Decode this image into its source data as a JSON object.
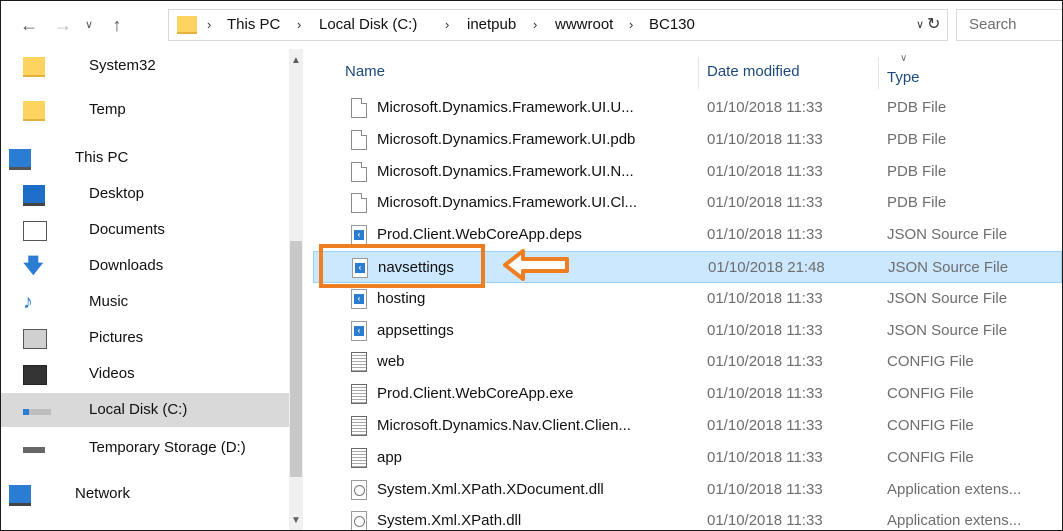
{
  "address_bar": {
    "crumbs": [
      "This PC",
      "Local Disk (C:)",
      "inetpub",
      "wwwroot",
      "BC130"
    ],
    "search_placeholder": "Search"
  },
  "nav_pane": {
    "items": [
      {
        "label": "System32",
        "icon": "folder-icon"
      },
      {
        "label": "Temp",
        "icon": "folder-icon"
      },
      {
        "label": "This PC",
        "icon": "computer-icon"
      },
      {
        "label": "Desktop",
        "icon": "desktop-icon"
      },
      {
        "label": "Documents",
        "icon": "documents-icon"
      },
      {
        "label": "Downloads",
        "icon": "downloads-icon"
      },
      {
        "label": "Music",
        "icon": "music-icon"
      },
      {
        "label": "Pictures",
        "icon": "pictures-icon"
      },
      {
        "label": "Videos",
        "icon": "videos-icon"
      },
      {
        "label": "Local Disk (C:)",
        "icon": "local-disk-icon",
        "selected": true
      },
      {
        "label": "Temporary Storage (D:)",
        "icon": "drive-icon"
      },
      {
        "label": "Network",
        "icon": "network-icon"
      }
    ]
  },
  "columns": {
    "name": "Name",
    "date": "Date modified",
    "type": "Type"
  },
  "files": [
    {
      "name": "Microsoft.Dynamics.Framework.UI.U...",
      "date": "01/10/2018 11:33",
      "type": "PDB File",
      "kind": "doc"
    },
    {
      "name": "Microsoft.Dynamics.Framework.UI.pdb",
      "date": "01/10/2018 11:33",
      "type": "PDB File",
      "kind": "doc"
    },
    {
      "name": "Microsoft.Dynamics.Framework.UI.N...",
      "date": "01/10/2018 11:33",
      "type": "PDB File",
      "kind": "doc"
    },
    {
      "name": "Microsoft.Dynamics.Framework.UI.Cl...",
      "date": "01/10/2018 11:33",
      "type": "PDB File",
      "kind": "doc"
    },
    {
      "name": "Prod.Client.WebCoreApp.deps",
      "date": "01/10/2018 11:33",
      "type": "JSON Source File",
      "kind": "json"
    },
    {
      "name": "navsettings",
      "date": "01/10/2018 21:48",
      "type": "JSON Source File",
      "kind": "json",
      "highlighted": true
    },
    {
      "name": "hosting",
      "date": "01/10/2018 11:33",
      "type": "JSON Source File",
      "kind": "json"
    },
    {
      "name": "appsettings",
      "date": "01/10/2018 11:33",
      "type": "JSON Source File",
      "kind": "json"
    },
    {
      "name": "web",
      "date": "01/10/2018 11:33",
      "type": "CONFIG File",
      "kind": "cfg"
    },
    {
      "name": "Prod.Client.WebCoreApp.exe",
      "date": "01/10/2018 11:33",
      "type": "CONFIG File",
      "kind": "cfg"
    },
    {
      "name": "Microsoft.Dynamics.Nav.Client.Clien...",
      "date": "01/10/2018 11:33",
      "type": "CONFIG File",
      "kind": "cfg"
    },
    {
      "name": "app",
      "date": "01/10/2018 11:33",
      "type": "CONFIG File",
      "kind": "cfg"
    },
    {
      "name": "System.Xml.XPath.XDocument.dll",
      "date": "01/10/2018 11:33",
      "type": "Application extens...",
      "kind": "dll"
    },
    {
      "name": "System.Xml.XPath.dll",
      "date": "01/10/2018 11:33",
      "type": "Application extens...",
      "kind": "dll"
    }
  ],
  "colors": {
    "accent": "#ef7d22",
    "selection": "#cce8ff"
  }
}
